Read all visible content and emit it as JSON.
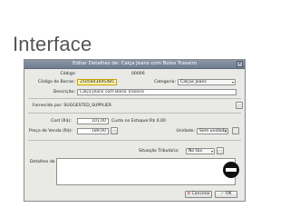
{
  "slide": {
    "title": "Interface"
  },
  "dialog": {
    "title": "Editar Detalhes de: Calça Jeans com Bolso Traseiro",
    "close_label": "x",
    "codigo_label": "Código:",
    "codigo_value": "00006",
    "barras_label": "Código de Barras:",
    "barras_value": "2505843695485",
    "categoria_label": "Categoria:",
    "categoria_value": "Calças Jeans",
    "descricao_label": "Descrição:",
    "descricao_value": "Calça Jeans com Bolso Traseiro",
    "fornecido_label": "Fornecido por:",
    "fornecido_value": "SUGGESTED_SUPPLIER",
    "more_label": "...",
    "cost_label": "Cost (R$):",
    "cost_value": "101,00",
    "custo_estoque_label": "Custo no Estoque:",
    "custo_estoque_value": "R$ 0,00",
    "preco_label": "Preço de Venda (R$):",
    "preco_value": "189,00",
    "unidade_label": "Unidade:",
    "unidade_value": "Sem unidade",
    "situacao_label": "Situação Tributária:",
    "situacao_value": "No tax",
    "detalhes_label": "Detalhes do Produto:",
    "cancel_label": "Cancelar",
    "ok_label": "OK"
  },
  "icons": {
    "stop": "stop-icon"
  },
  "colors": {
    "barcode_highlight": "#fff7b0",
    "titlebar": "#7b879a"
  }
}
